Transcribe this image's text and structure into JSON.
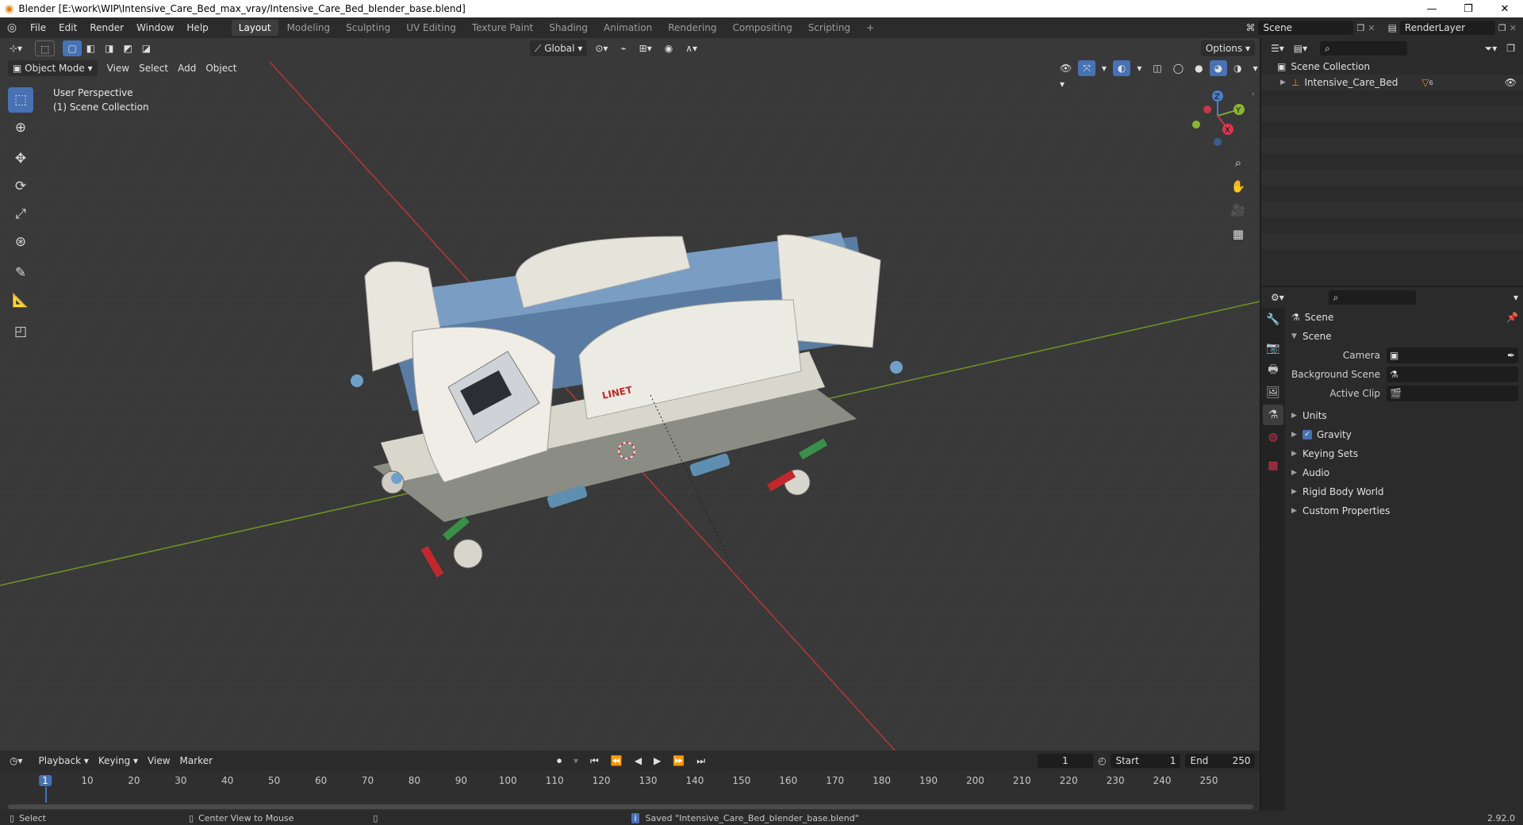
{
  "title_bar": {
    "title": "Blender [E:\\work\\WIP\\Intensive_Care_Bed_max_vray/Intensive_Care_Bed_blender_base.blend]",
    "minimize": "—",
    "restore": "❐",
    "close": "✕"
  },
  "menu": {
    "items": [
      "File",
      "Edit",
      "Render",
      "Window",
      "Help"
    ]
  },
  "workspaces": {
    "tabs": [
      "Layout",
      "Modeling",
      "Sculpting",
      "UV Editing",
      "Texture Paint",
      "Shading",
      "Animation",
      "Rendering",
      "Compositing",
      "Scripting"
    ],
    "active": "Layout",
    "add": "+"
  },
  "scene_selector": {
    "value": "Scene"
  },
  "render_layer": {
    "value": "RenderLayer"
  },
  "viewport_header": {
    "transform_orientation": "Global",
    "options_label": "Options",
    "mode": "Object Mode",
    "menus": [
      "View",
      "Select",
      "Add",
      "Object"
    ]
  },
  "viewport": {
    "perspective_label": "User Perspective",
    "collection_label": "(1) Scene Collection",
    "bed_brand": "LINET",
    "gizmo": {
      "z": "Z",
      "y": "Y",
      "x": "X"
    }
  },
  "timeline": {
    "menus": [
      "Playback",
      "Keying",
      "View",
      "Marker"
    ],
    "current_frame": "1",
    "start_label": "Start",
    "start_value": "1",
    "end_label": "End",
    "end_value": "250",
    "ruler": [
      "1",
      "10",
      "20",
      "30",
      "40",
      "50",
      "60",
      "70",
      "80",
      "90",
      "100",
      "110",
      "120",
      "130",
      "140",
      "150",
      "160",
      "170",
      "180",
      "190",
      "200",
      "210",
      "220",
      "230",
      "240",
      "250"
    ]
  },
  "status_bar": {
    "select": "Select",
    "center_view": "Center View to Mouse",
    "saved_message": "Saved \"Intensive_Care_Bed_blender_base.blend\"",
    "version": "2.92.0"
  },
  "outliner": {
    "root": "Scene Collection",
    "children": [
      {
        "label": "Intensive_Care_Bed",
        "badge": "6"
      }
    ]
  },
  "properties": {
    "context": "Scene",
    "panel_title": "Scene",
    "fields": [
      {
        "label": "Camera"
      },
      {
        "label": "Background Scene"
      },
      {
        "label": "Active Clip"
      }
    ],
    "subpanels": [
      {
        "label": "Units"
      },
      {
        "label": "Gravity",
        "checked": true
      },
      {
        "label": "Keying Sets"
      },
      {
        "label": "Audio"
      },
      {
        "label": "Rigid Body World"
      },
      {
        "label": "Custom Properties"
      }
    ]
  },
  "colors": {
    "accent": "#4772b3",
    "x_axis": "#c23b3b",
    "y_axis": "#7a9e2a",
    "viewport_bg": "#393939"
  }
}
